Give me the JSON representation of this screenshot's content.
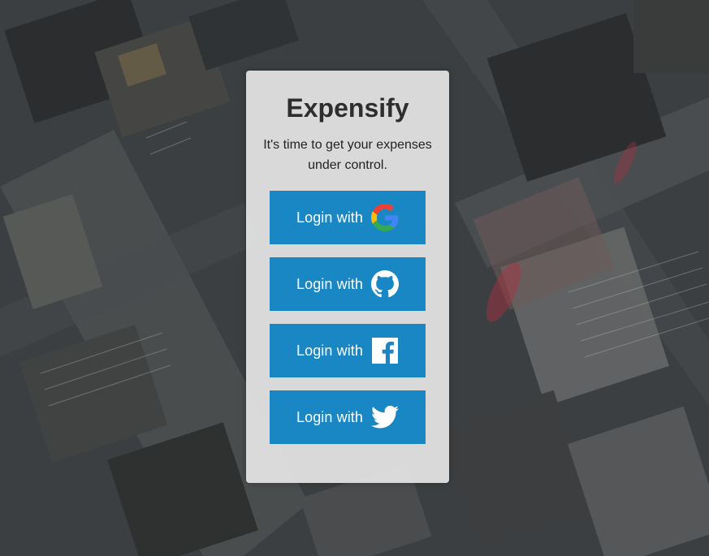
{
  "app": {
    "title": "Expensify",
    "tagline": "It's time to get your expenses under control."
  },
  "login_buttons": [
    {
      "label": "Login with",
      "provider_icon": "google-icon"
    },
    {
      "label": "Login with",
      "provider_icon": "github-icon"
    },
    {
      "label": "Login with",
      "provider_icon": "facebook-icon"
    },
    {
      "label": "Login with",
      "provider_icon": "twitter-icon"
    }
  ],
  "colors": {
    "button_bg": "#1a87c5",
    "card_bg": "#e5e5e5",
    "title_text": "#2e2e2e"
  }
}
